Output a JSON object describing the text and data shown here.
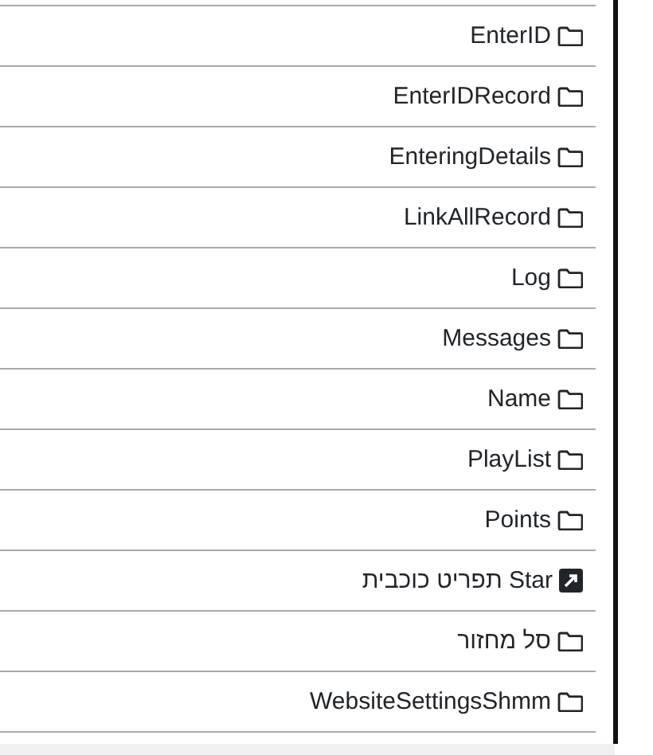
{
  "items": [
    {
      "label": "EnterID",
      "kind": "folder"
    },
    {
      "label": "EnterIDRecord",
      "kind": "folder"
    },
    {
      "label": "EnteringDetails",
      "kind": "folder"
    },
    {
      "label": "LinkAllRecord",
      "kind": "folder"
    },
    {
      "label": "Log",
      "kind": "folder"
    },
    {
      "label": "Messages",
      "kind": "folder"
    },
    {
      "label": "Name",
      "kind": "folder"
    },
    {
      "label": "PlayList",
      "kind": "folder"
    },
    {
      "label": "Points",
      "kind": "folder"
    },
    {
      "label": "Star תפריט כוכבית",
      "kind": "shortcut"
    },
    {
      "label": "סל מחזור",
      "kind": "folder"
    },
    {
      "label": "WebsiteSettingsShmm",
      "kind": "folder"
    }
  ]
}
